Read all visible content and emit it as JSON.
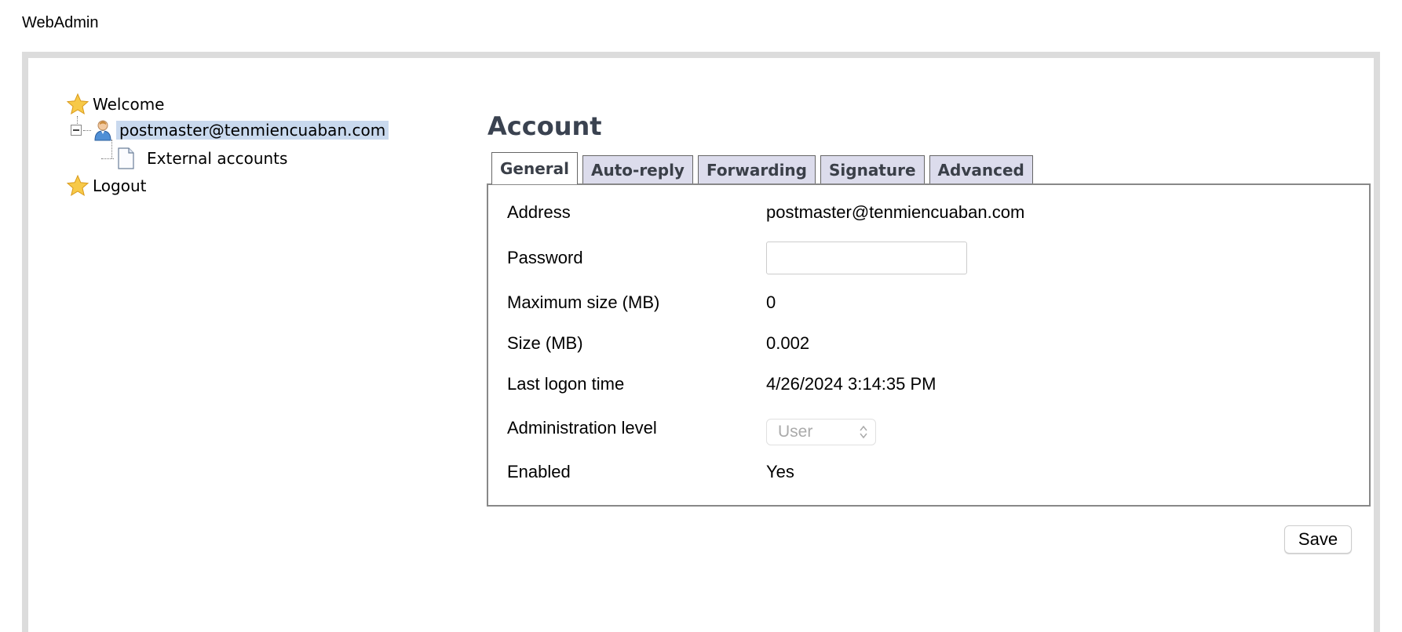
{
  "app": {
    "title": "WebAdmin"
  },
  "tree": {
    "welcome": "Welcome",
    "account": "postmaster@tenmiencuaban.com",
    "external_accounts": "External accounts",
    "logout": "Logout"
  },
  "account": {
    "title": "Account",
    "tabs": [
      {
        "label": "General",
        "active": true
      },
      {
        "label": "Auto-reply",
        "active": false
      },
      {
        "label": "Forwarding",
        "active": false
      },
      {
        "label": "Signature",
        "active": false
      },
      {
        "label": "Advanced",
        "active": false
      }
    ],
    "fields": {
      "address_label": "Address",
      "address_value": "postmaster@tenmiencuaban.com",
      "password_label": "Password",
      "password_value": "",
      "max_size_label": "Maximum size (MB)",
      "max_size_value": "0",
      "size_label": "Size (MB)",
      "size_value": "0.002",
      "last_logon_label": "Last logon time",
      "last_logon_value": "4/26/2024 3:14:35 PM",
      "admin_level_label": "Administration level",
      "admin_level_value": "User",
      "enabled_label": "Enabled",
      "enabled_value": "Yes"
    },
    "save_label": "Save"
  },
  "colors": {
    "selection": "#c9d9ee",
    "tab_inactive": "#dcdcec",
    "title_text": "#3a4250",
    "frame_border": "#dcdcdc"
  }
}
